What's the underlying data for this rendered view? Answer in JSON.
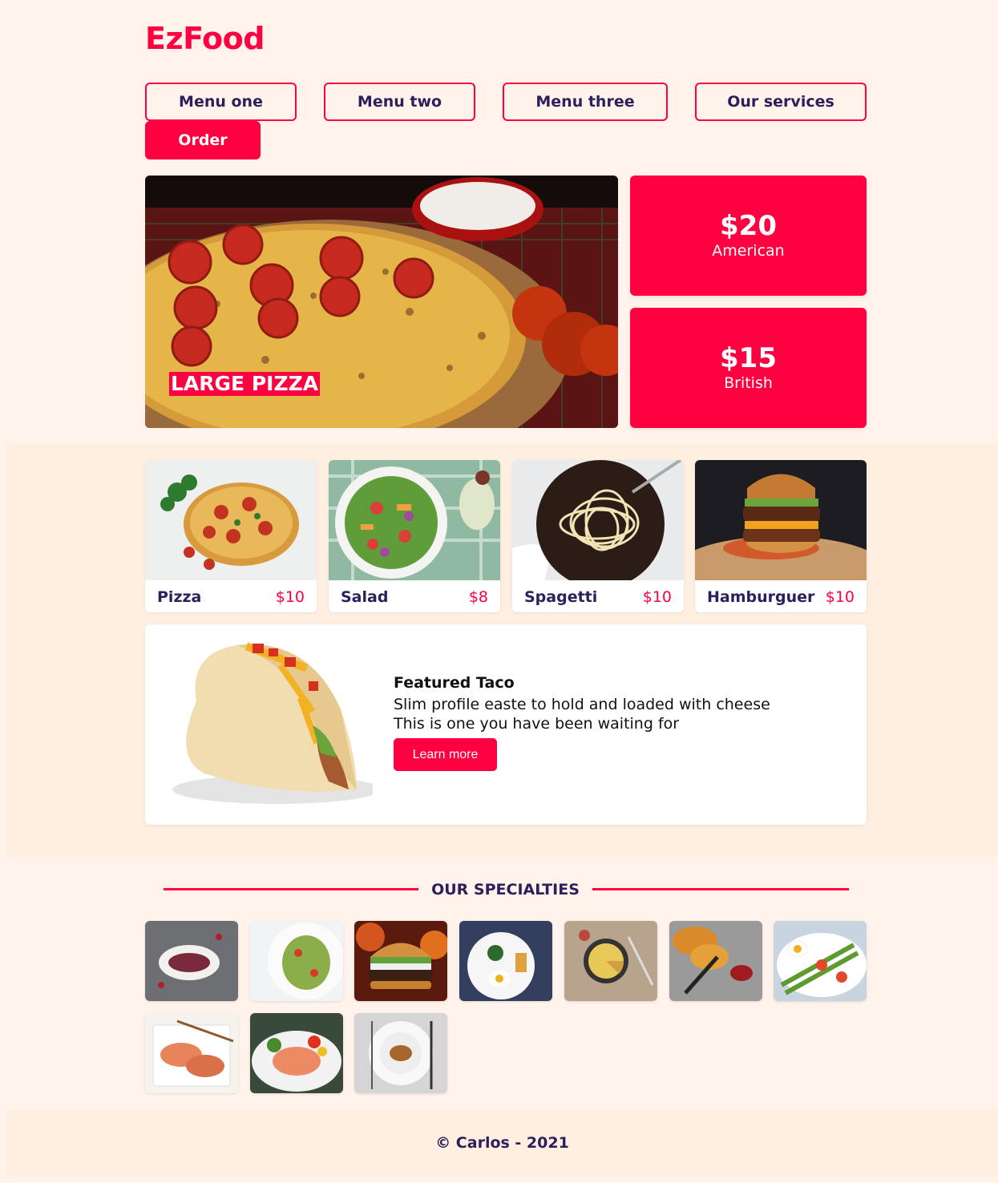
{
  "brand": {
    "logo": "EzFood",
    "accent": "#ff0040",
    "text_color": "#2b1f5c"
  },
  "nav": {
    "items": [
      {
        "label": "Menu one"
      },
      {
        "label": "Menu two"
      },
      {
        "label": "Menu three"
      },
      {
        "label": "Our services"
      }
    ],
    "order_label": "Order"
  },
  "hero": {
    "caption": "LARGE PIZZA",
    "image": "pizza-photo"
  },
  "offers": [
    {
      "price": "$20",
      "origin": "American"
    },
    {
      "price": "$15",
      "origin": "British"
    }
  ],
  "menu_cards": [
    {
      "name": "Pizza",
      "price": "$10",
      "image": "pizza-photo"
    },
    {
      "name": "Salad",
      "price": "$8",
      "image": "salad-photo"
    },
    {
      "name": "Spagetti",
      "price": "$10",
      "image": "spaghetti-photo"
    },
    {
      "name": "Hamburguer",
      "price": "$10",
      "image": "burger-photo"
    }
  ],
  "featured": {
    "title": "Featured Taco",
    "line1": "Slim profile easte to hold and loaded with cheese",
    "line2": "This is one you have been waiting for",
    "button": "Learn more",
    "image": "taco-photo"
  },
  "specialties": {
    "heading": "OUR SPECIALTIES",
    "thumbnails": [
      "dessert-plate",
      "pasta-salad",
      "burger",
      "breakfast-plate",
      "quiche",
      "croissants",
      "egg-asparagus-salad",
      "salmon-dish",
      "salmon-salad",
      "plated-entree"
    ]
  },
  "footer": {
    "text": "© Carlos - 2021"
  }
}
